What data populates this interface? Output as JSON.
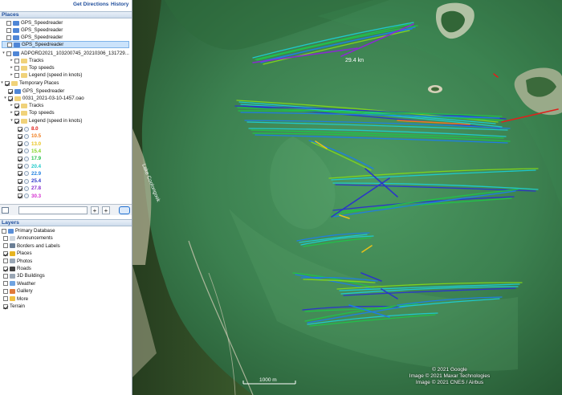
{
  "topbar": {
    "get_directions": "Get Directions",
    "history": "History"
  },
  "places": {
    "header": "Places",
    "items": [
      {
        "label": "GPS_Speedreader",
        "checked": false
      },
      {
        "label": "GPS_Speedreader",
        "checked": false
      },
      {
        "label": "GPS_Speedreader",
        "checked": false
      },
      {
        "label": "GPS_Speedreader",
        "checked": false,
        "selected": true
      },
      {
        "label": "ADPORD2021_103200745_20210306_131729...",
        "checked": false
      },
      {
        "label": "Tracks",
        "checked": false
      },
      {
        "label": "Top speeds",
        "checked": false
      },
      {
        "label": "Legend (speed in knots)",
        "checked": false
      },
      {
        "label": "Temporary Places",
        "checked": true
      },
      {
        "label": "GPS_Speedreader",
        "checked": true
      },
      {
        "label": "0031_2021-03-10-1457.oao",
        "checked": true
      },
      {
        "label": "Tracks",
        "checked": true
      },
      {
        "label": "Top speeds",
        "checked": true
      },
      {
        "label": "Legend (speed in knots)",
        "checked": true
      }
    ],
    "legend": [
      {
        "value": "8.0",
        "color": "#e0201c"
      },
      {
        "value": "10.5",
        "color": "#f07a1a"
      },
      {
        "value": "13.0",
        "color": "#e8c21a"
      },
      {
        "value": "15.4",
        "color": "#7fd21e"
      },
      {
        "value": "17.9",
        "color": "#22c04a"
      },
      {
        "value": "20.4",
        "color": "#1fc9c9"
      },
      {
        "value": "22.9",
        "color": "#1f7fe0"
      },
      {
        "value": "25.4",
        "color": "#2b36c8"
      },
      {
        "value": "27.8",
        "color": "#8a2bd0"
      },
      {
        "value": "30.3",
        "color": "#d42bd0"
      }
    ]
  },
  "layers": {
    "header": "Layers",
    "items": [
      {
        "label": "Primary Database",
        "checked": false,
        "icon": "globe-icon",
        "icon_color": "#5a8fd8"
      },
      {
        "label": "Announcements",
        "checked": false,
        "icon": "announcement-icon",
        "icon_color": "#cfd6de"
      },
      {
        "label": "Borders and Labels",
        "checked": false,
        "icon": "flag-icon",
        "icon_color": "#6b7f96"
      },
      {
        "label": "Places",
        "checked": true,
        "icon": "place-icon",
        "icon_color": "#e6b422"
      },
      {
        "label": "Photos",
        "checked": false,
        "icon": "camera-icon",
        "icon_color": "#9aa7b5"
      },
      {
        "label": "Roads",
        "checked": true,
        "icon": "road-icon",
        "icon_color": "#444"
      },
      {
        "label": "3D Buildings",
        "checked": false,
        "icon": "building-icon",
        "icon_color": "#9aa7b5"
      },
      {
        "label": "Weather",
        "checked": false,
        "icon": "weather-icon",
        "icon_color": "#6fa3e0"
      },
      {
        "label": "Gallery",
        "checked": false,
        "icon": "gallery-icon",
        "icon_color": "#e07a3a"
      },
      {
        "label": "More",
        "checked": false,
        "icon": "more-icon",
        "icon_color": "#f0c040"
      },
      {
        "label": "Terrain",
        "checked": true,
        "icon": "",
        "icon_color": ""
      }
    ]
  },
  "map": {
    "track_label": "29.4 kn",
    "lake_label": "Lake Coolongook",
    "scale_label": "1000 m",
    "credits": [
      "© 2021 Google",
      "Image © 2021 Maxar Technologies",
      "Image © 2021 CNES / Airbus"
    ]
  }
}
